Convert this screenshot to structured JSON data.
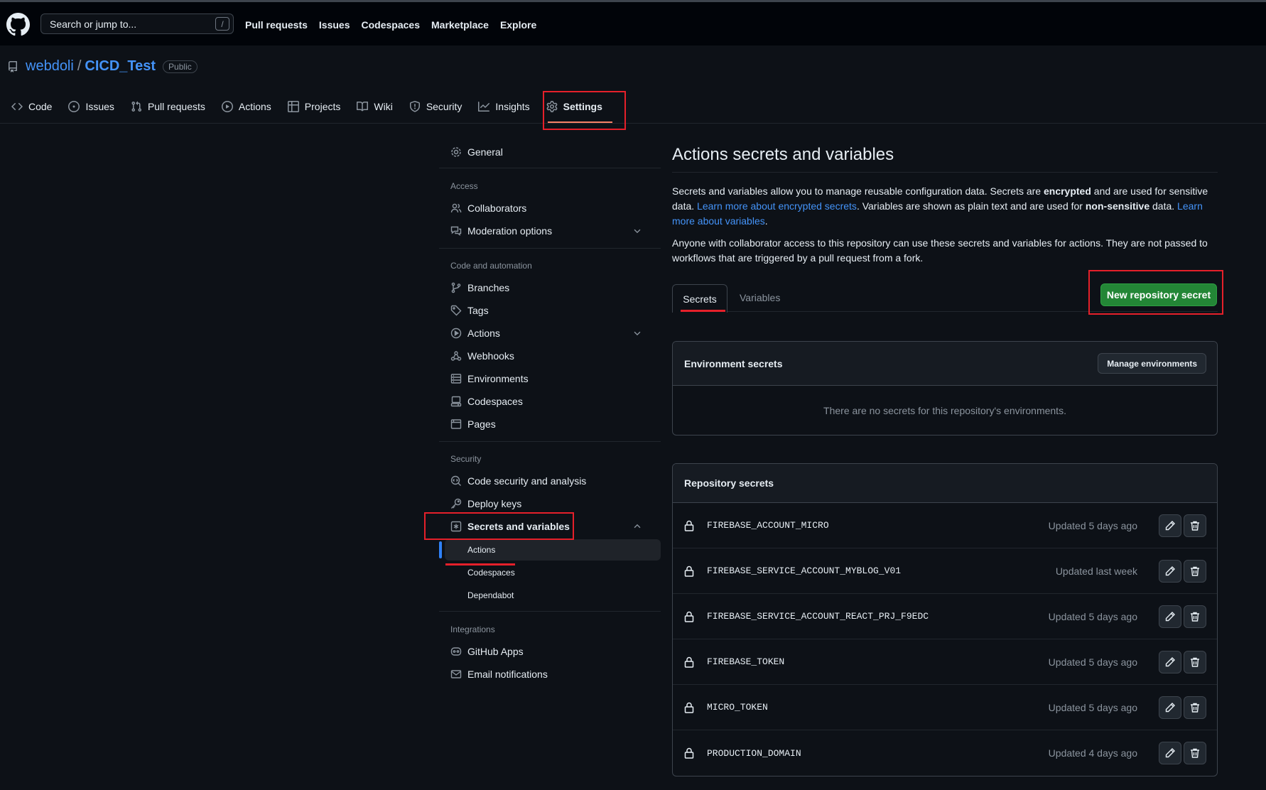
{
  "header": {
    "search_placeholder": "Search or jump to...",
    "search_shortcut": "/",
    "nav": [
      "Pull requests",
      "Issues",
      "Codespaces",
      "Marketplace",
      "Explore"
    ]
  },
  "repo": {
    "owner": "webdoli",
    "separator": "/",
    "name": "CICD_Test",
    "visibility": "Public"
  },
  "repo_tabs": [
    {
      "label": "Code",
      "icon": "code-icon"
    },
    {
      "label": "Issues",
      "icon": "issue-icon"
    },
    {
      "label": "Pull requests",
      "icon": "pull-request-icon"
    },
    {
      "label": "Actions",
      "icon": "play-icon"
    },
    {
      "label": "Projects",
      "icon": "table-icon"
    },
    {
      "label": "Wiki",
      "icon": "book-icon"
    },
    {
      "label": "Security",
      "icon": "shield-icon"
    },
    {
      "label": "Insights",
      "icon": "graph-icon"
    },
    {
      "label": "Settings",
      "icon": "gear-icon"
    }
  ],
  "sidebar": {
    "general": "General",
    "access_heading": "Access",
    "collaborators": "Collaborators",
    "moderation": "Moderation options",
    "code_heading": "Code and automation",
    "branches": "Branches",
    "tags": "Tags",
    "actions": "Actions",
    "webhooks": "Webhooks",
    "environments": "Environments",
    "codespaces": "Codespaces",
    "pages": "Pages",
    "security_heading": "Security",
    "code_security": "Code security and analysis",
    "deploy_keys": "Deploy keys",
    "secrets_vars": "Secrets and variables",
    "sub_actions": "Actions",
    "sub_codespaces": "Codespaces",
    "sub_dependabot": "Dependabot",
    "integrations_heading": "Integrations",
    "github_apps": "GitHub Apps",
    "email_notifications": "Email notifications"
  },
  "main": {
    "title": "Actions secrets and variables",
    "p1_a": "Secrets and variables allow you to manage reusable configuration data. Secrets are ",
    "p1_b": "encrypted",
    "p1_c": " and are used for sensitive data. ",
    "p1_link1": "Learn more about encrypted secrets",
    "p1_d": ". Variables are shown as plain text and are used for ",
    "p1_e": "non-sensitive",
    "p1_f": " data. ",
    "p1_link2": "Learn more about variables",
    "p1_g": ".",
    "p2": "Anyone with collaborator access to this repository can use these secrets and variables for actions. They are not passed to workflows that are triggered by a pull request from a fork.",
    "tab_secrets": "Secrets",
    "tab_variables": "Variables",
    "new_secret_button": "New repository secret",
    "env_heading": "Environment secrets",
    "manage_env_button": "Manage environments",
    "env_empty": "There are no secrets for this repository's environments.",
    "repo_heading": "Repository secrets",
    "secrets": [
      {
        "name": "FIREBASE_ACCOUNT_MICRO",
        "updated": "Updated 5 days ago"
      },
      {
        "name": "FIREBASE_SERVICE_ACCOUNT_MYBLOG_V01",
        "updated": "Updated last week"
      },
      {
        "name": "FIREBASE_SERVICE_ACCOUNT_REACT_PRJ_F9EDC",
        "updated": "Updated 5 days ago"
      },
      {
        "name": "FIREBASE_TOKEN",
        "updated": "Updated 5 days ago"
      },
      {
        "name": "MICRO_TOKEN",
        "updated": "Updated 5 days ago"
      },
      {
        "name": "PRODUCTION_DOMAIN",
        "updated": "Updated 4 days ago"
      }
    ]
  },
  "colors": {
    "highlight": "#e5202a",
    "accent_blue": "#4493f8",
    "primary_green": "#238636"
  }
}
